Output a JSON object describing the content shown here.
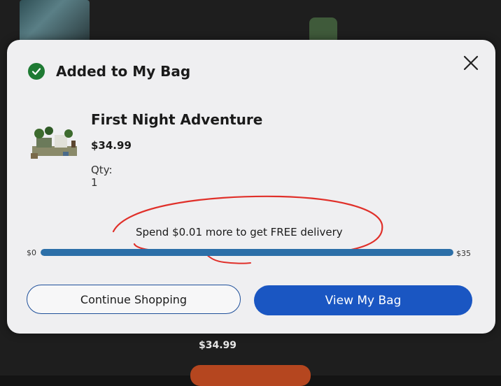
{
  "background": {
    "price": "$34.99"
  },
  "modal": {
    "title": "Added to My Bag",
    "product": {
      "name": "First Night Adventure",
      "price": "$34.99",
      "qty": "Qty: 1"
    },
    "delivery": {
      "message": "Spend $0.01 more to get FREE delivery",
      "min_label": "$0",
      "max_label": "$35",
      "progress_fraction": 0.9997
    },
    "buttons": {
      "continue": "Continue Shopping",
      "view_bag": "View My Bag"
    },
    "icons": [
      "check-circle-icon",
      "close-icon"
    ],
    "colors": {
      "accent": "#1a56c2",
      "success": "#1e7a33",
      "progress": "#2c6fa8"
    }
  }
}
